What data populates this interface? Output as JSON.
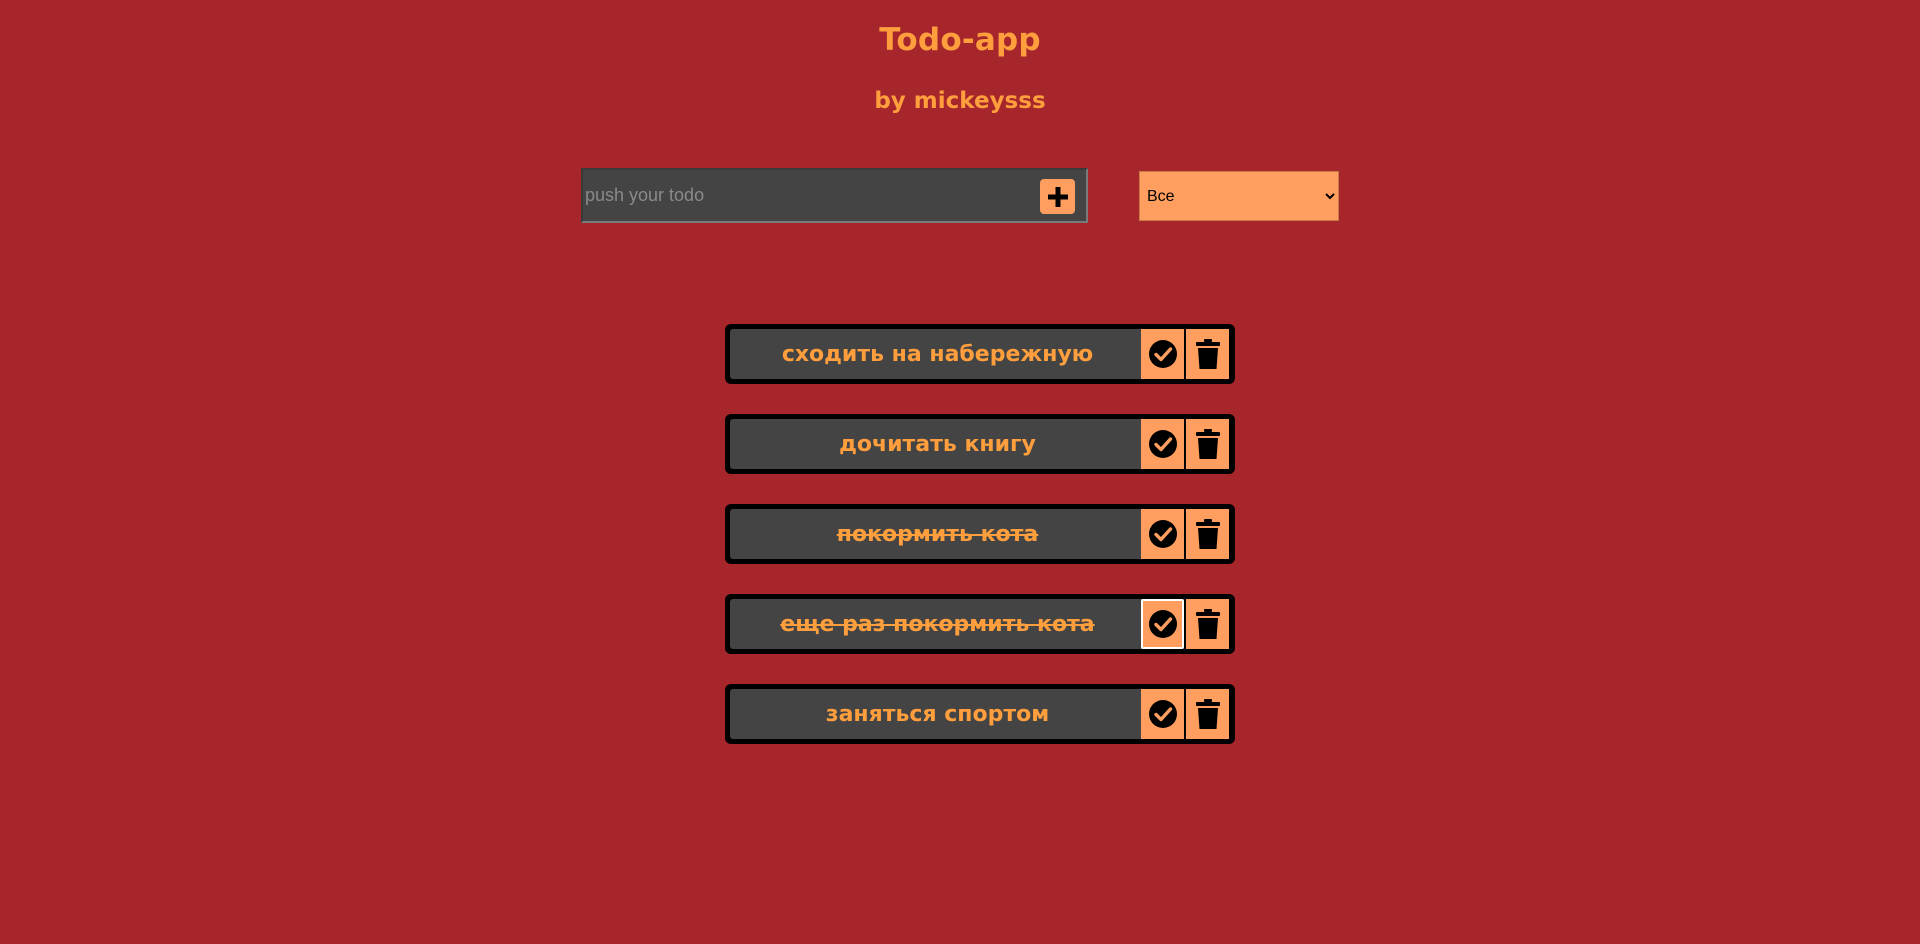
{
  "header": {
    "title": "Todo-app",
    "subtitle": "by mickeysss"
  },
  "form": {
    "placeholder": "push your todo",
    "value": "",
    "add_icon": "plus-icon"
  },
  "filter": {
    "selected": "Все"
  },
  "todos": [
    {
      "text": "сходить на набережную",
      "completed": false
    },
    {
      "text": "дочитать книгу",
      "completed": false
    },
    {
      "text": "покормить кота",
      "completed": true
    },
    {
      "text": "еще раз покормить кота",
      "completed": true
    },
    {
      "text": "заняться спортом",
      "completed": false
    }
  ],
  "icons": {
    "complete": "check-circle-icon",
    "delete": "trash-icon"
  },
  "colors": {
    "background": "#a6262c",
    "accent_text": "#ff9e3d",
    "button": "#ff9e5f",
    "panel": "#444444"
  }
}
